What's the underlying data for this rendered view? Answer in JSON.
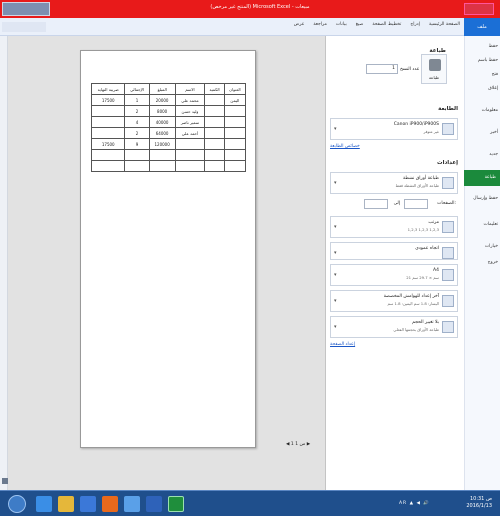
{
  "titlebar": {
    "title": "‫مبيعات - Microsoft Excel (المنتج غير مرخص)‬"
  },
  "tabs": [
    "ملف",
    "الصفحة الرئيسية",
    "إدراج",
    "تخطيط الصفحة",
    "صيغ",
    "بيانات",
    "مراجعة",
    "عرض"
  ],
  "file_tab": "ملف",
  "nav": {
    "items": [
      "حفظ",
      "حفظ باسم",
      "فتح",
      "إغلاق",
      "معلومات",
      "أخير",
      "جديد",
      "طباعة",
      "حفظ وإرسال",
      "تعليمات",
      "خيارات",
      "خروج"
    ],
    "selected": "طباعة"
  },
  "print": {
    "heading": "طباعة",
    "button": "طباعة",
    "copies_label": "عدد النسخ",
    "copies_value": "1",
    "printer_heading": "الطابعة",
    "printer_name": "Canon iP900/iP900S",
    "printer_status": "غير متوفر",
    "printer_props": "خصائص الطابعة",
    "settings_heading": "إعدادات",
    "settings_rows": [
      {
        "t1": "طباعة أوراق نشطة",
        "t2": "طباعة الأوراق النشطة فقط"
      },
      {
        "t1": "مرتب",
        "t2": "1,2,3   1,2,3   1,2,3"
      },
      {
        "t1": "اتجاه عمودي",
        "t2": ""
      },
      {
        "t1": "A4",
        "t2": "21 سم × 29.7 سم"
      },
      {
        "t1": "آخر إعداد للهوامش المخصصة",
        "t2": "اليسار: 1.8 سم   اليمين: 1.8 سم"
      },
      {
        "t1": "بلا تغيير الحجم",
        "t2": "طباعة الأوراق بحجمها الفعلي"
      }
    ],
    "pages_label": "الصفحات:",
    "to_label": "إلى",
    "page_setup": "إعداد الصفحة"
  },
  "sheet": {
    "headers": [
      "العنوان",
      "الكمية",
      "الاسم",
      "المبلغ",
      "الإجمالي",
      "ضريبة النهاية"
    ],
    "rows": [
      [
        "اليمن",
        "",
        "محمد علي",
        "20000",
        "1",
        "17500"
      ],
      [
        "",
        "",
        "وليد حسن",
        "8000",
        "2",
        ""
      ],
      [
        "",
        "",
        "سمير ناصر",
        "40000",
        "4",
        ""
      ],
      [
        "",
        "",
        "أحمد علي",
        "64000",
        "2",
        ""
      ],
      [
        "",
        "",
        "",
        "120000",
        "9",
        "17500"
      ],
      [
        "",
        "",
        "",
        "",
        "",
        ""
      ],
      [
        "",
        "",
        "",
        "",
        "",
        ""
      ]
    ]
  },
  "pager": "◀ 1 من 1 ▶",
  "taskbar": {
    "tray": "AR  ▲ ◀ 🔊",
    "time": "10:31 ص",
    "date": "2016/1/13"
  }
}
